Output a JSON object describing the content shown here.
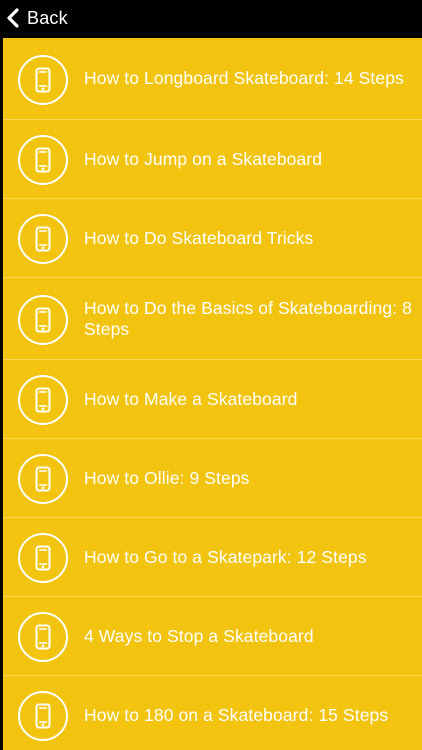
{
  "header": {
    "back_label": "Back"
  },
  "items": [
    {
      "label": "How to Longboard Skateboard: 14 Steps",
      "icon": "phone-icon"
    },
    {
      "label": "How to Jump on a Skateboard",
      "icon": "phone-icon"
    },
    {
      "label": "How to Do Skateboard Tricks",
      "icon": "phone-icon"
    },
    {
      "label": "How to Do the Basics of Skateboarding: 8 Steps",
      "icon": "phone-icon"
    },
    {
      "label": "How to Make a Skateboard",
      "icon": "phone-icon"
    },
    {
      "label": "How to Ollie: 9 Steps",
      "icon": "phone-icon"
    },
    {
      "label": "How to Go to a Skatepark: 12 Steps",
      "icon": "phone-icon"
    },
    {
      "label": "4 Ways to Stop a Skateboard",
      "icon": "phone-icon"
    },
    {
      "label": "How to 180 on a Skateboard: 15 Steps",
      "icon": "phone-icon"
    }
  ],
  "colors": {
    "background": "#000000",
    "panel": "#F2C40F",
    "divider": "#F6D654",
    "text": "#FFFFFF"
  }
}
